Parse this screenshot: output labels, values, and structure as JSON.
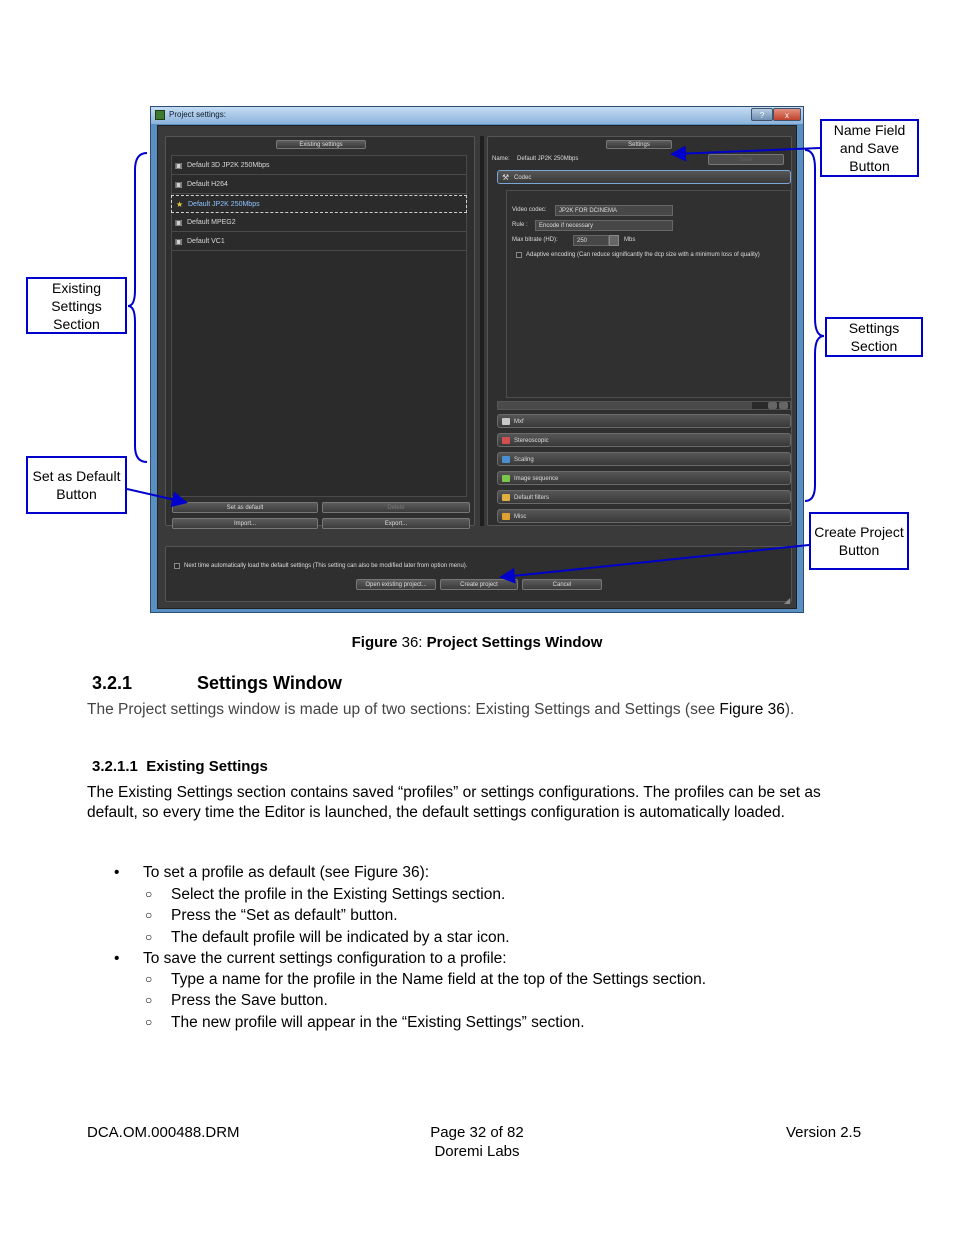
{
  "window": {
    "title": "Project settings:",
    "help_label": "?",
    "close_label": "x",
    "existing_header": "Existing settings",
    "settings_header": "Settings",
    "profiles": [
      {
        "name": "Default 3D JP2K 250Mbps",
        "icon": "lock-icon"
      },
      {
        "name": "Default H264",
        "icon": "lock-icon"
      },
      {
        "name": "Default JP2K 250Mbps",
        "icon": "star-icon",
        "selected": true
      },
      {
        "name": "Default MPEG2",
        "icon": "lock-icon"
      },
      {
        "name": "Default VC1",
        "icon": "lock-icon"
      }
    ],
    "set_default_label": "Set as default",
    "delete_label": "Delete",
    "import_label": "Import...",
    "export_label": "Export...",
    "name_label": "Name:",
    "name_value": "Default JP2K 250Mbps",
    "save_label": "Save",
    "codec_label": "Codec",
    "video_codec_label": "Video codec:",
    "video_codec_value": "JP2K FOR DCINEMA",
    "rule_label": "Rule :",
    "rule_value": "Encode if necessary",
    "max_bitrate_label": "Max bitrate (HD):",
    "max_bitrate_value": "250",
    "max_bitrate_unit": "Mbs",
    "adaptive_label": "Adaptive encoding (Can reduce significantly the dcp size with a minimum loss of quality)",
    "sections": [
      {
        "label": "Mxf",
        "color": "#c9c9c9"
      },
      {
        "label": "Stereoscopic",
        "color": "#d05050"
      },
      {
        "label": "Scaling",
        "color": "#4a90d0"
      },
      {
        "label": "Image sequence",
        "color": "#7bc74a"
      },
      {
        "label": "Default filters",
        "color": "#e0b040"
      },
      {
        "label": "Misc",
        "color": "#e0a030"
      }
    ],
    "autoload_label": "Next time automatically load the default settings (This setting can also be modified later from option menu).",
    "open_existing_label": "Open existing project...",
    "create_project_label": "Create project",
    "cancel_label": "Cancel"
  },
  "callouts": {
    "name_field": "Name Field and Save Button",
    "existing": "Existing Settings Section",
    "settings": "Settings Section",
    "set_default": "Set as Default Button",
    "create_project": "Create Project Button"
  },
  "caption": {
    "prefix": "Figure",
    "number": "36:",
    "title": "Project Settings Window"
  },
  "section": {
    "number": "3.2.1",
    "title": "Settings Window"
  },
  "intro": "The Project settings window is made up of two sections: Existing Settings and Settings (see ",
  "intro_ref": "Figure 36",
  "intro_end": ").",
  "subsection": {
    "number": "3.2.1.1",
    "title": "Existing Settings"
  },
  "existing_para": "The Existing Settings section contains saved “profiles” or settings configurations. The profiles can be set as default, so every time the Editor is launched, the default settings configuration is automatically loaded.",
  "bullets": [
    {
      "text": "To set a profile as default (see Figure 36):",
      "subs": [
        "Select the profile in the Existing Settings section.",
        "Press the “Set as default” button.",
        "The default profile will be indicated by a star icon."
      ]
    },
    {
      "text": "To save the current settings configuration to a profile:",
      "subs": [
        "Type a name for the profile in the Name field at the top of the Settings section.",
        "Press the Save button.",
        "The new profile will appear in the “Existing Settings” section."
      ]
    }
  ],
  "footer": {
    "left": "DCA.OM.000488.DRM",
    "center_line1": "Page 32 of 82",
    "center_line2": "Doremi Labs",
    "right": "Version 2.5"
  }
}
